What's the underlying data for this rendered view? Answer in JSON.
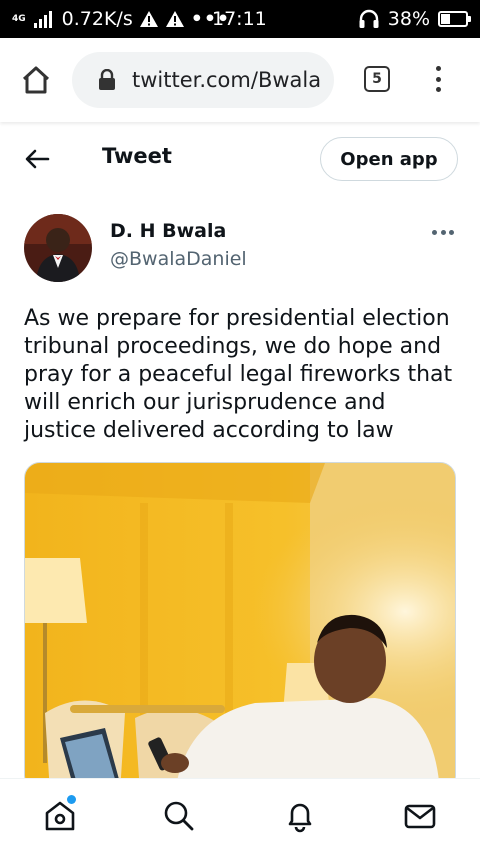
{
  "status_bar": {
    "network_type": "4G",
    "speed": "0.72K/s",
    "dots": "•••",
    "time": "17:11",
    "battery": "38%",
    "battery_level": 0.38
  },
  "browser": {
    "url": "twitter.com/Bwala",
    "tab_count": "5"
  },
  "header": {
    "title": "Tweet",
    "open_app_label": "Open app"
  },
  "tweet": {
    "author_name": "D. H Bwala",
    "author_handle": "@BwalaDaniel",
    "text": "As we prepare for presidential election tribunal proceedings, we do hope and pray for a peaceful legal fireworks that will enrich our jurisprudence and justice delivered according to law"
  },
  "nav": {
    "items": [
      "home-icon",
      "search-icon",
      "notifications-icon",
      "messages-icon"
    ],
    "accent": "#1d9bf0"
  }
}
